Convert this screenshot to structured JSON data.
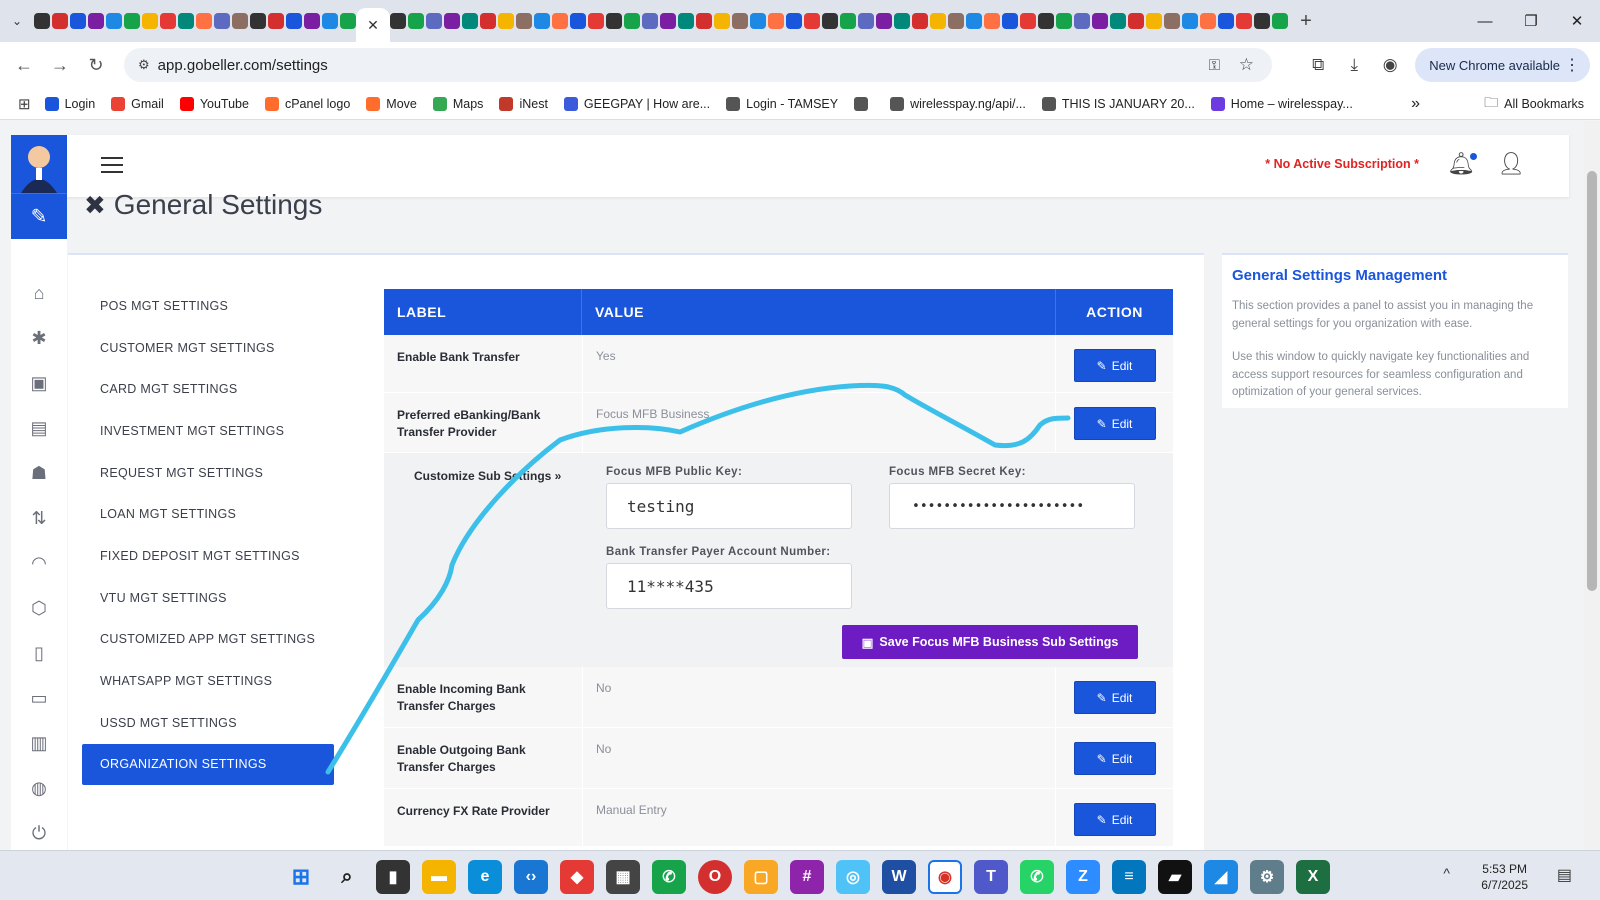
{
  "browser": {
    "active_tab_close": "✕",
    "new_tab": "+",
    "url": "app.gobeller.com/settings",
    "chrome_update": "New Chrome available",
    "win_minimize": "—",
    "win_restore": "❐",
    "win_close": "✕",
    "bookmarks": [
      {
        "label": "Login",
        "color": "#1a56db"
      },
      {
        "label": "Gmail",
        "color": "#ea4335"
      },
      {
        "label": "YouTube",
        "color": "#ff0000"
      },
      {
        "label": "cPanel logo",
        "color": "#ff6c2c"
      },
      {
        "label": "Move",
        "color": "#ff6c2c"
      },
      {
        "label": "Maps",
        "color": "#34a853"
      },
      {
        "label": "iNest",
        "color": "#c0392b"
      },
      {
        "label": "GEEGPAY | How are...",
        "color": "#3b5bdb"
      },
      {
        "label": "Login - TAMSEY",
        "color": "#555555"
      },
      {
        "label": "",
        "color": "#555555"
      },
      {
        "label": "wirelesspay.ng/api/...",
        "color": "#555555"
      },
      {
        "label": "THIS IS JANUARY 20...",
        "color": "#555555"
      },
      {
        "label": "Home – wirelesspay...",
        "color": "#6c3ce0"
      }
    ],
    "bookmarks_more": "»",
    "all_bookmarks": "All Bookmarks"
  },
  "header": {
    "subscription_notice": "* No Active Subscription *"
  },
  "page": {
    "title": "General Settings"
  },
  "settings_menu": {
    "items": [
      "POS MGT SETTINGS",
      "CUSTOMER MGT SETTINGS",
      "CARD MGT SETTINGS",
      "INVESTMENT MGT SETTINGS",
      "REQUEST MGT SETTINGS",
      "LOAN MGT SETTINGS",
      "FIXED DEPOSIT MGT SETTINGS",
      "VTU MGT SETTINGS",
      "CUSTOMIZED APP MGT SETTINGS",
      "WHATSAPP MGT SETTINGS",
      "USSD MGT SETTINGS",
      "ORGANIZATION SETTINGS"
    ],
    "active_index": 11
  },
  "table": {
    "headers": [
      "LABEL",
      "VALUE",
      "ACTION"
    ],
    "edit_label": "Edit",
    "rows": [
      {
        "label": "Enable Bank Transfer",
        "value": "Yes"
      },
      {
        "label": "Preferred eBanking/Bank Transfer Provider",
        "value": "Focus MFB Business"
      },
      {
        "label": "Enable Incoming Bank Transfer Charges",
        "value": "No"
      },
      {
        "label": "Enable Outgoing Bank Transfer Charges",
        "value": "No"
      },
      {
        "label": "Currency FX Rate Provider",
        "value": "Manual Entry"
      }
    ]
  },
  "sub_settings": {
    "toggle_label": "Customize Sub Settings »",
    "public_key_label": "Focus MFB Public Key:",
    "public_key_value": "testing",
    "secret_key_label": "Focus MFB Secret Key:",
    "secret_key_value": "••••••••••••••••••••••",
    "account_label": "Bank Transfer Payer Account Number:",
    "account_value": "11****435",
    "save_label": "Save Focus MFB Business Sub Settings"
  },
  "info_panel": {
    "title": "General Settings Management",
    "paragraph1": "This section provides a panel to assist you in managing the general settings for you organization with ease.",
    "paragraph2": "Use this window to quickly navigate key functionalities and access support resources for seamless configuration and optimization of your general services."
  },
  "taskbar": {
    "time": "5:53 PM",
    "date": "6/7/2025",
    "tray_chevron": "^"
  },
  "colors": {
    "primary": "#1a56db",
    "save_button": "#6d1bc2",
    "alert": "#e02424",
    "scribble": "#3cc0ea"
  }
}
